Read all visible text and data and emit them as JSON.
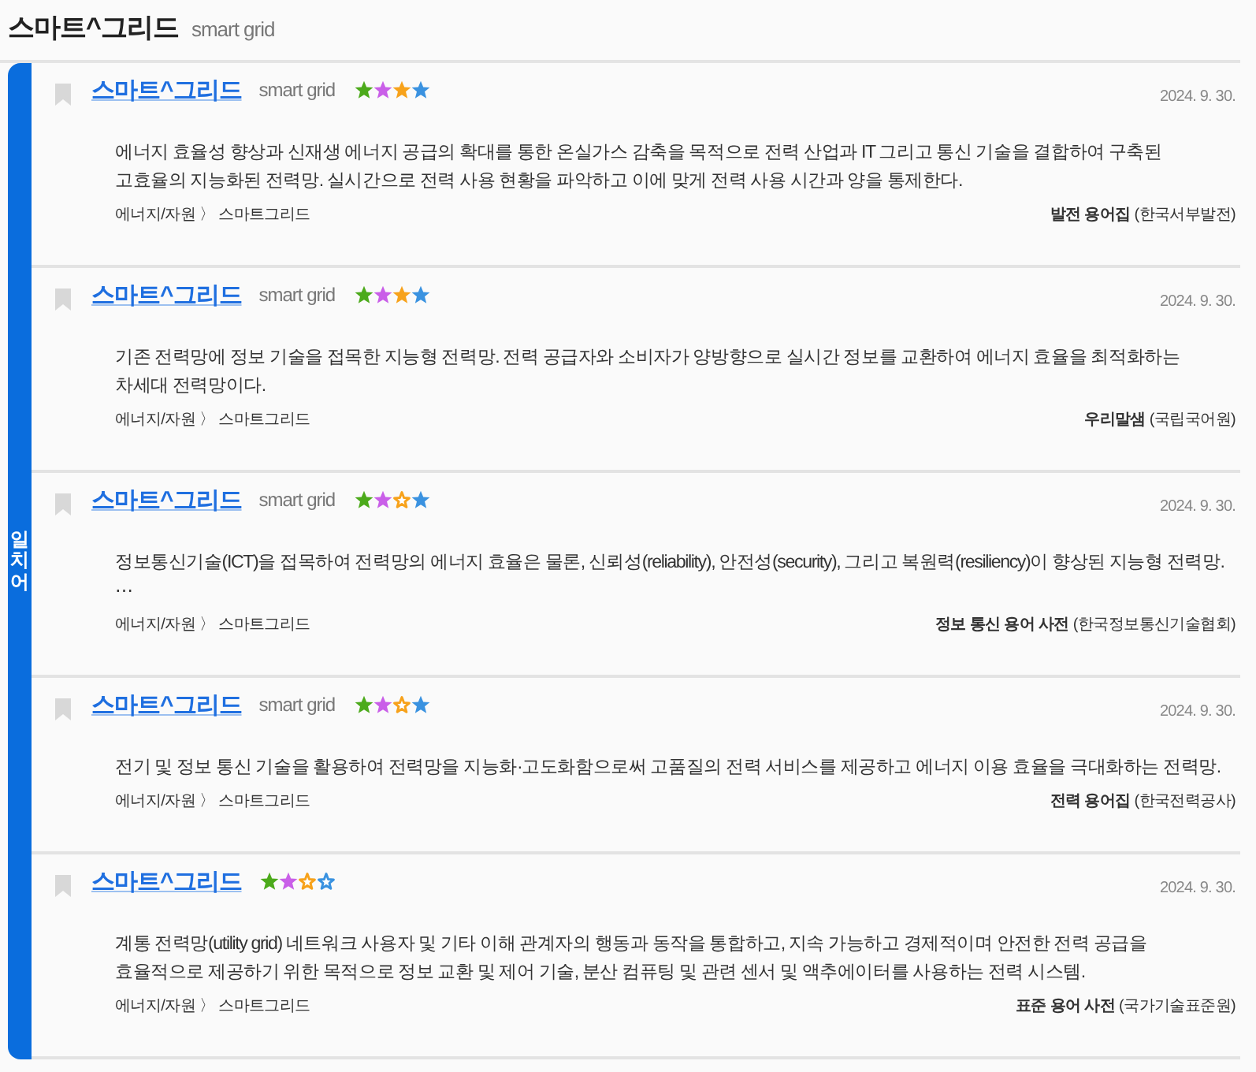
{
  "header": {
    "title": "스마트^그리드",
    "english": "smart grid"
  },
  "group": {
    "label": "일치어"
  },
  "entries": [
    {
      "term": "스마트^그리드",
      "english": "smart grid",
      "rating": [
        {
          "color": "#4caa1b",
          "filled": true
        },
        {
          "color": "#c95fe8",
          "filled": true
        },
        {
          "color": "#f7a21b",
          "filled": true
        },
        {
          "color": "#3a92e0",
          "filled": true
        }
      ],
      "date": "2024. 9. 30.",
      "definition": "에너지 효율성 향상과 신재생 에너지 공급의 확대를 통한 온실가스 감축을 목적으로 전력 산업과 IT 그리고 통신 기술을 결합하여 구축된 고효율의 지능화된 전력망. 실시간으로 전력 사용 현황을 파악하고 이에 맞게 전력 사용 시간과 양을 통제한다.",
      "category": "에너지/자원 〉 스마트그리드",
      "source": "**발전 용어집** (한국서부발전)"
    },
    {
      "term": "스마트^그리드",
      "english": "smart grid",
      "rating": [
        {
          "color": "#4caa1b",
          "filled": true
        },
        {
          "color": "#c95fe8",
          "filled": true
        },
        {
          "color": "#f7a21b",
          "filled": true
        },
        {
          "color": "#3a92e0",
          "filled": true
        }
      ],
      "date": "2024. 9. 30.",
      "definition": "기존 전력망에 정보 기술을 접목한 지능형 전력망. 전력 공급자와 소비자가 양방향으로 실시간 정보를 교환하여 에너지 효율을 최적화하는 차세대 전력망이다.",
      "category": "에너지/자원 〉 스마트그리드",
      "source": "**우리말샘** (국립국어원)"
    },
    {
      "term": "스마트^그리드",
      "english": "smart grid",
      "rating": [
        {
          "color": "#4caa1b",
          "filled": true
        },
        {
          "color": "#c95fe8",
          "filled": true
        },
        {
          "color": "#f7a21b",
          "filled": false
        },
        {
          "color": "#3a92e0",
          "filled": true
        }
      ],
      "date": "2024. 9. 30.",
      "definition": "정보통신기술(ICT)을 접목하여 전력망의 에너지 효율은 물론, 신뢰성(reliability), 안전성(security), 그리고 복원력(resiliency)이 향상된 지능형 전력망. ⋯",
      "category": "에너지/자원 〉 스마트그리드",
      "source": "**정보 통신 용어 사전** (한국정보통신기술협회)"
    },
    {
      "term": "스마트^그리드",
      "english": "smart grid",
      "rating": [
        {
          "color": "#4caa1b",
          "filled": true
        },
        {
          "color": "#c95fe8",
          "filled": true
        },
        {
          "color": "#f7a21b",
          "filled": false
        },
        {
          "color": "#3a92e0",
          "filled": true
        }
      ],
      "date": "2024. 9. 30.",
      "definition": "전기 및 정보 통신 기술을 활용하여 전력망을 지능화·고도화함으로써 고품질의 전력 서비스를 제공하고 에너지 이용 효율을 극대화하는 전력망.",
      "category": "에너지/자원 〉 스마트그리드",
      "source": "**전력 용어집** (한국전력공사)"
    },
    {
      "term": "스마트^그리드",
      "rating": [
        {
          "color": "#4caa1b",
          "filled": true
        },
        {
          "color": "#c95fe8",
          "filled": true
        },
        {
          "color": "#f7a21b",
          "filled": false
        },
        {
          "color": "#3a92e0",
          "filled": false
        }
      ],
      "date": "2024. 9. 30.",
      "definition": "계통 전력망(utility grid) 네트워크 사용자 및 기타 이해 관계자의 행동과 동작을 통합하고, 지속 가능하고 경제적이며 안전한 전력 공급을 효율적으로 제공하기 위한 목적으로 정보 교환 및 제어 기술, 분산 컴퓨팅 및 관련 센서 및 액추에이터를 사용하는 전력 시스템.",
      "category": "에너지/자원 〉 스마트그리드",
      "source": "**표준 용어 사전** (국가기술표준원)"
    }
  ]
}
